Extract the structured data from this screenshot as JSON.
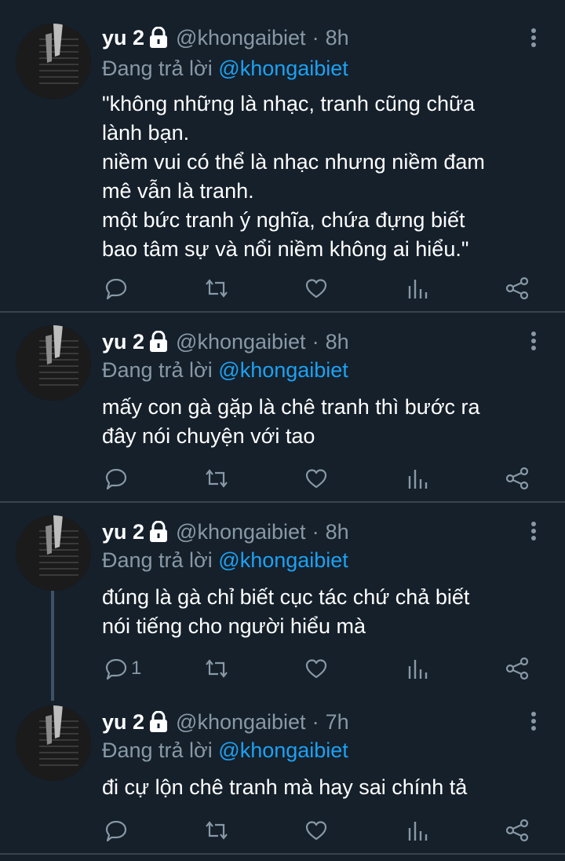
{
  "colors": {
    "background": "#15202b",
    "divider": "#38444d",
    "muted": "#8899a6",
    "mention": "#1da1f2",
    "text": "#ffffff"
  },
  "tweets": [
    {
      "name": "yu 2",
      "handle": "@khongaibiet",
      "dot": "·",
      "time": "8h",
      "reply_prefix": "Đang trả lời",
      "reply_mention": "@khongaibiet",
      "lines": [
        "\"không những là nhạc, tranh cũng chữa",
        "lành bạn.",
        "niềm vui có thể là nhạc nhưng niềm đam",
        "mê vẫn là tranh.",
        "một bức tranh ý nghĩa, chứa đựng biết",
        "bao tâm sự và nổi niềm không ai hiểu.\""
      ],
      "reply_count": "",
      "icons": [
        "lock-icon",
        "more-icon",
        "reply-icon",
        "retweet-icon",
        "like-icon",
        "analytics-icon",
        "share-icon"
      ]
    },
    {
      "name": "yu 2",
      "handle": "@khongaibiet",
      "dot": "·",
      "time": "8h",
      "reply_prefix": "Đang trả lời",
      "reply_mention": "@khongaibiet",
      "lines": [
        "mấy con gà gặp là chê tranh thì bước ra",
        "đây nói chuyện với tao"
      ],
      "reply_count": ""
    },
    {
      "name": "yu 2",
      "handle": "@khongaibiet",
      "dot": "·",
      "time": "8h",
      "reply_prefix": "Đang trả lời",
      "reply_mention": "@khongaibiet",
      "lines": [
        "đúng là gà chỉ biết cục tác chứ chả biết",
        "nói tiếng cho người hiểu mà"
      ],
      "reply_count": "1"
    },
    {
      "name": "yu 2",
      "handle": "@khongaibiet",
      "dot": "·",
      "time": "7h",
      "reply_prefix": "Đang trả lời",
      "reply_mention": "@khongaibiet",
      "lines": [
        "đi cự lộn chê tranh mà hay sai chính tả"
      ],
      "reply_count": ""
    }
  ]
}
